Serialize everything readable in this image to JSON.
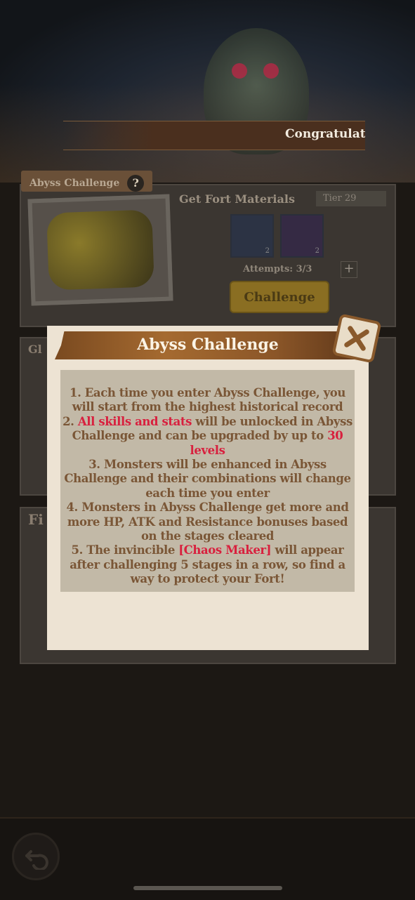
{
  "background": {
    "banner_text": "Congratulation"
  },
  "card1": {
    "tab_label": "Abyss Challenge",
    "help_symbol": "?",
    "title": "Get Fort Materials",
    "tier": "Tier 29",
    "materials": [
      {
        "name": "fort-material-1",
        "count": "2"
      },
      {
        "name": "fort-material-2",
        "count": "2"
      }
    ],
    "attempts": "Attempts: 3/3",
    "plus": "+",
    "challenge_label": "Challenge"
  },
  "card2": {
    "tab_label": "Gl"
  },
  "card3": {
    "tab_label": "Fi"
  },
  "modal": {
    "title": "Abyss Challenge",
    "rules": [
      {
        "parts": [
          {
            "t": "1. Each time you enter Abyss Challenge, you will start from the highest historical record"
          }
        ]
      },
      {
        "parts": [
          {
            "t": "2. "
          },
          {
            "t": "All skills and stats",
            "hl": true
          },
          {
            "t": " will be unlocked in Abyss Challenge and can be upgraded by up to "
          },
          {
            "t": "30 levels",
            "hl": true
          }
        ]
      },
      {
        "parts": [
          {
            "t": "3. Monsters will be enhanced in Abyss Challenge and their combinations will change each time you enter"
          }
        ]
      },
      {
        "parts": [
          {
            "t": "4. Monsters in Abyss Challenge get more and more HP, ATK and Resistance bonuses based on the stages cleared"
          }
        ]
      },
      {
        "parts": [
          {
            "t": "5. The invincible "
          },
          {
            "t": "[Chaos Maker]",
            "hl": true
          },
          {
            "t": " will appear after challenging 5 stages in a row, so find a way to protect your Fort!"
          }
        ]
      }
    ]
  },
  "icons": {
    "close": "close-icon",
    "back": "back-arrow-icon"
  },
  "colors": {
    "highlight": "#d8203e",
    "text": "#7a5636",
    "modal_bg": "#ede3d3"
  }
}
